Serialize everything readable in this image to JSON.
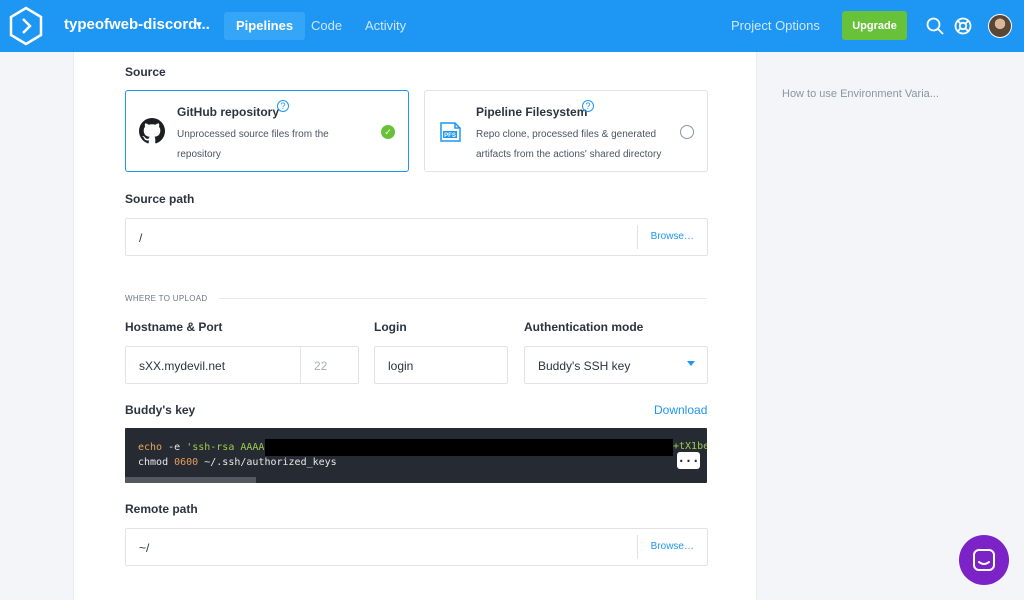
{
  "header": {
    "project_name": "typeofweb-discord...",
    "tabs": [
      {
        "label": "Pipelines",
        "active": true
      },
      {
        "label": "Code",
        "active": false
      },
      {
        "label": "Activity",
        "active": false
      }
    ],
    "project_options": "Project Options",
    "upgrade": "Upgrade",
    "icons": [
      "buddy-logo-icon",
      "chevron-down-icon",
      "search-icon",
      "help-lifebuoy-icon",
      "user-avatar"
    ],
    "colors": {
      "bar": "#1e96f3",
      "upgrade": "#67c23a"
    }
  },
  "source": {
    "label": "Source",
    "options": [
      {
        "title": "GitHub repository",
        "desc_line1": "Unprocessed source files from the",
        "desc_line2": "repository",
        "selected": true,
        "icon": "github-icon"
      },
      {
        "title": "Pipeline Filesystem",
        "desc_line1": "Repo clone, processed files & generated",
        "desc_line2": "artifacts from the actions' shared directory",
        "selected": false,
        "icon": "pfs-icon",
        "icon_text": "PFS"
      }
    ],
    "help_glyph": "?"
  },
  "source_path": {
    "label": "Source path",
    "value": "/",
    "browse": "Browse…"
  },
  "upload": {
    "section_title": "WHERE TO UPLOAD",
    "hostname_label": "Hostname & Port",
    "hostname_value": "sXX.mydevil.net",
    "port_value": "22",
    "login_label": "Login",
    "login_value": "login",
    "auth_label": "Authentication mode",
    "auth_value": "Buddy's SSH key"
  },
  "buddys_key": {
    "label": "Buddy's key",
    "download": "Download",
    "line1_cmd": "echo",
    "line1_flag": " -e ",
    "line1_str": "'ssh-rsa AAAA8",
    "line1_tail": "+tX1be",
    "line2_cmd": "chmod ",
    "line2_num": "0600",
    "line2_rest": " ~/.ssh/authorized_keys",
    "more": "..."
  },
  "remote_path": {
    "label": "Remote path",
    "value": "~/",
    "browse": "Browse…"
  },
  "sidebar": {
    "help_link": "How to use Environment Varia..."
  },
  "chat": {
    "icon": "chat-icon",
    "color": "#7c23c7"
  }
}
